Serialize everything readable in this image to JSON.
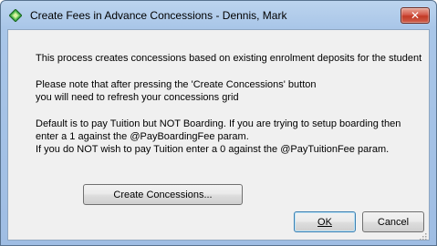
{
  "window": {
    "title": "Create Fees in Advance Concessions - Dennis, Mark",
    "close_symbol": "✕",
    "title_icon": "app-diamond-icon"
  },
  "message": {
    "line1": "This process creates concessions based on existing enrolment deposits for the student",
    "line2": "Please note that after pressing the 'Create Concessions' button",
    "line3": "you will need to refresh your concessions grid",
    "line4": "Default is to pay Tuition but NOT Boarding.  If you are trying to setup boarding then",
    "line5": "enter a 1 against the @PayBoardingFee param.",
    "line6": "If you do NOT wish to pay Tuition enter a 0 against the @PayTuitionFee param."
  },
  "buttons": {
    "create": "Create Concessions...",
    "ok": "OK",
    "cancel": "Cancel"
  },
  "colors": {
    "frame": "#a9c6e8",
    "client": "#f0f0f0",
    "close": "#c23a26"
  }
}
